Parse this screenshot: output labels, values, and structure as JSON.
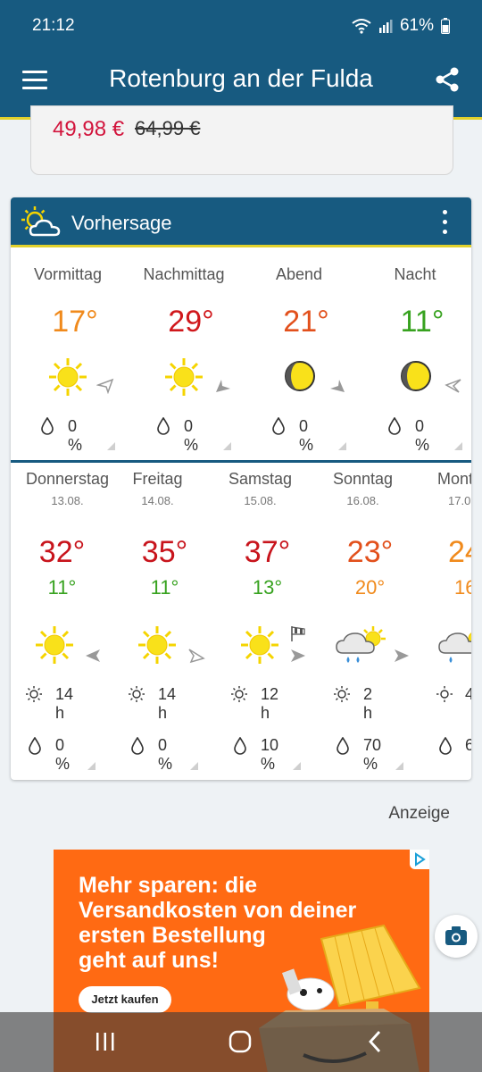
{
  "status": {
    "time": "21:12",
    "battery": "61%"
  },
  "header": {
    "title": "Rotenburg an der Fulda"
  },
  "price_card": {
    "price_new": "49,98 €",
    "price_old": "64,99 €"
  },
  "forecast": {
    "title": "Vorhersage",
    "dayparts": [
      {
        "label": "Vormittag",
        "temp": "17°",
        "color": "#f08a1c",
        "icon": "sun-icon",
        "wind": "wind-arrow-icon",
        "precip": "0 %"
      },
      {
        "label": "Nachmittag",
        "temp": "29°",
        "color": "#d0181c",
        "icon": "sun-icon",
        "wind": "wind-arrow-icon",
        "precip": "0 %"
      },
      {
        "label": "Abend",
        "temp": "21°",
        "color": "#e2501c",
        "icon": "moon-icon",
        "wind": "wind-arrow-icon",
        "precip": "0 %"
      },
      {
        "label": "Nacht",
        "temp": "11°",
        "color": "#37a21f",
        "icon": "moon-icon",
        "wind": "wind-arrow-icon",
        "precip": "0 %"
      }
    ],
    "days": [
      {
        "name": "Donnerstag",
        "date": "13.08.",
        "max": "32°",
        "max_color": "#c8141c",
        "min": "11°",
        "min_color": "#37a21f",
        "icon": "sun-icon",
        "sun": "14 h",
        "precip": "0 %"
      },
      {
        "name": "Freitag",
        "date": "14.08.",
        "max": "35°",
        "max_color": "#c8141c",
        "min": "11°",
        "min_color": "#37a21f",
        "icon": "sun-icon",
        "sun": "14 h",
        "precip": "0 %"
      },
      {
        "name": "Samstag",
        "date": "15.08.",
        "max": "37°",
        "max_color": "#c8141c",
        "min": "13°",
        "min_color": "#37a21f",
        "icon": "sun-icon",
        "sun": "12 h",
        "precip": "10 %"
      },
      {
        "name": "Sonntag",
        "date": "16.08.",
        "max": "23°",
        "max_color": "#e2501c",
        "min": "20°",
        "min_color": "#f08a1c",
        "icon": "rain-cloud-sun-icon",
        "sun": "2 h",
        "precip": "70 %"
      },
      {
        "name": "Mont",
        "date": "17.0",
        "max": "24",
        "max_color": "#f08a1c",
        "min": "16",
        "min_color": "#f08a1c",
        "icon": "rain-cloud-sun-icon",
        "sun": "4",
        "precip": "6"
      }
    ]
  },
  "ad": {
    "label": "Anzeige",
    "headline": "Mehr sparen: die\nVersandkosten von deiner\nersten Bestellung\ngeht auf uns!",
    "button": "Jetzt kaufen"
  }
}
